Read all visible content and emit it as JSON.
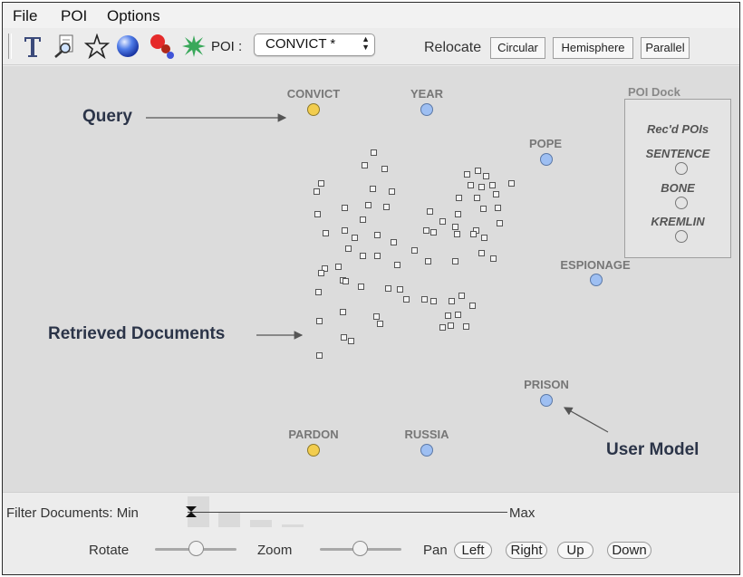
{
  "menu": {
    "items": [
      "File",
      "POI",
      "Options"
    ]
  },
  "toolbar": {
    "icons": [
      "text-icon",
      "magnifier-icon",
      "star-icon",
      "sphere-icon",
      "cluster-icon",
      "burst-icon"
    ],
    "poi_label": "POI :",
    "poi_selected": "CONVICT *",
    "relocate_label": "Relocate",
    "relocate_buttons": [
      "Circular",
      "Hemisphere",
      "Parallel"
    ]
  },
  "canvas": {
    "pois": [
      {
        "name": "CONVICT",
        "color": "#f2cd4e"
      },
      {
        "name": "YEAR",
        "color": "#9ebff2"
      },
      {
        "name": "POPE",
        "color": "#9ebff2"
      },
      {
        "name": "ESPIONAGE",
        "color": "#9ebff2"
      },
      {
        "name": "PRISON",
        "color": "#9ebff2"
      },
      {
        "name": "RUSSIA",
        "color": "#9ebff2"
      },
      {
        "name": "PARDON",
        "color": "#f2cd4e"
      }
    ],
    "annotations": {
      "query": "Query",
      "retrieved": "Retrieved Documents",
      "user_model": "User Model"
    },
    "dock": {
      "title": "POI Dock",
      "heading": "Rec'd POIs",
      "items": [
        "SENTENCE",
        "BONE",
        "KREMLIN"
      ]
    }
  },
  "controls": {
    "filter_label": "Filter Documents: Min",
    "filter_max": "Max",
    "rotate_label": "Rotate",
    "zoom_label": "Zoom",
    "pan_label": "Pan",
    "pan_buttons": [
      "Left",
      "Right",
      "Up",
      "Down"
    ]
  }
}
